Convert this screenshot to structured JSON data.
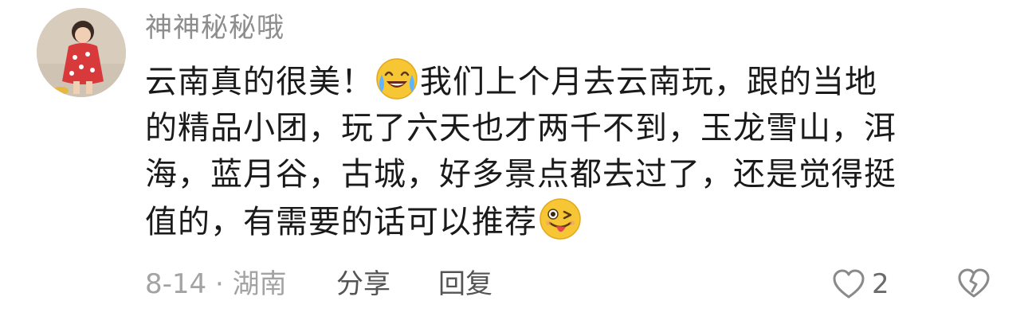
{
  "comment": {
    "username": "神神秘秘哦",
    "lines": [
      [
        "云南真的很美！",
        "我们上个月去云南玩，跟的当地"
      ],
      [
        "的精品小团，玩了六天也才两千不到，玉龙雪山，洱"
      ],
      [
        "海，蓝月谷，古城，好多景点都去过了，还是觉得挺"
      ],
      [
        "值的，有需要的话可以推荐"
      ]
    ],
    "emojis": [
      "tears-of-joy-emoji",
      "winking-tongue-emoji"
    ],
    "date_location": "8-14 · 湖南",
    "share_label": "分享",
    "reply_label": "回复",
    "like_count": "2",
    "icons": {
      "like": "heart-outline-icon",
      "dislike": "broken-heart-outline-icon"
    },
    "colors": {
      "username": "#8d8d8d",
      "body_text": "#1a1a1a",
      "meta": "#a3a3a3",
      "action": "#545454"
    }
  }
}
